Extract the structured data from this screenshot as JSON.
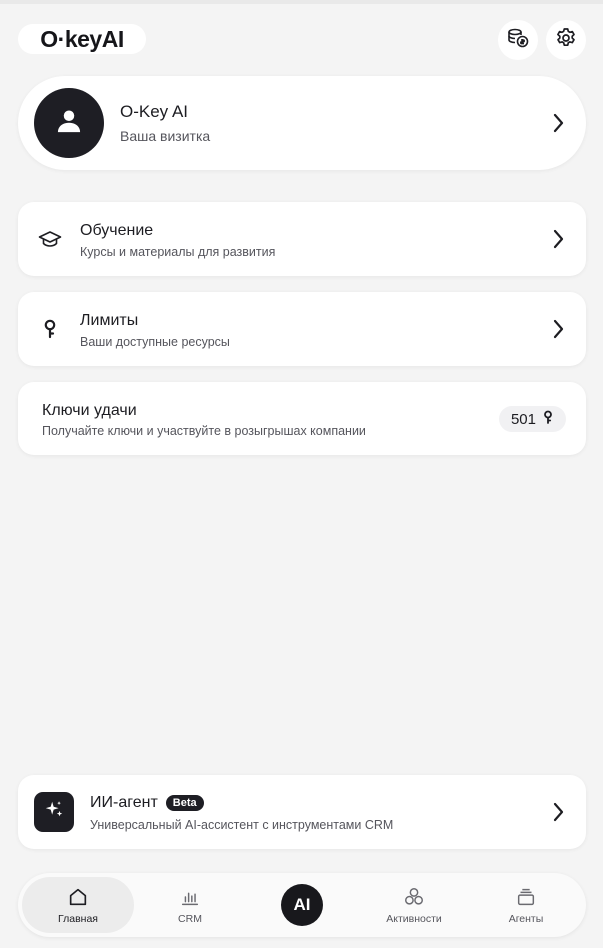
{
  "header": {
    "logo_text": "O·keyAI",
    "coins_icon": "coins-icon",
    "settings_icon": "gear-icon"
  },
  "profile": {
    "name": "O-Key AI",
    "subtitle": "Ваша визитка"
  },
  "menu": {
    "learning": {
      "title": "Обучение",
      "description": "Курсы и материалы для развития",
      "icon": "graduation-cap-icon"
    },
    "limits": {
      "title": "Лимиты",
      "description": "Ваши доступные ресурсы",
      "icon": "key-icon"
    },
    "keys": {
      "title": "Ключи удачи",
      "description": "Получайте ключи и участвуйте в розыгрышах компании",
      "count": "501"
    }
  },
  "agent": {
    "title": "ИИ-агент",
    "badge": "Beta",
    "description": "Универсальный AI-ассистент с инструментами CRM",
    "icon": "sparkles-icon"
  },
  "nav": {
    "items": [
      {
        "label": "Главная",
        "icon": "home-icon",
        "active": true
      },
      {
        "label": "CRM",
        "icon": "bar-chart-icon",
        "active": false
      },
      {
        "label": "AI",
        "icon": "ai-button",
        "active": false
      },
      {
        "label": "Активности",
        "icon": "circles-icon",
        "active": false
      },
      {
        "label": "Агенты",
        "icon": "stack-icon",
        "active": false
      }
    ]
  },
  "colors": {
    "background": "#f4f4f4",
    "card": "#ffffff",
    "dark": "#1e1e24",
    "text_secondary": "#55555c"
  }
}
